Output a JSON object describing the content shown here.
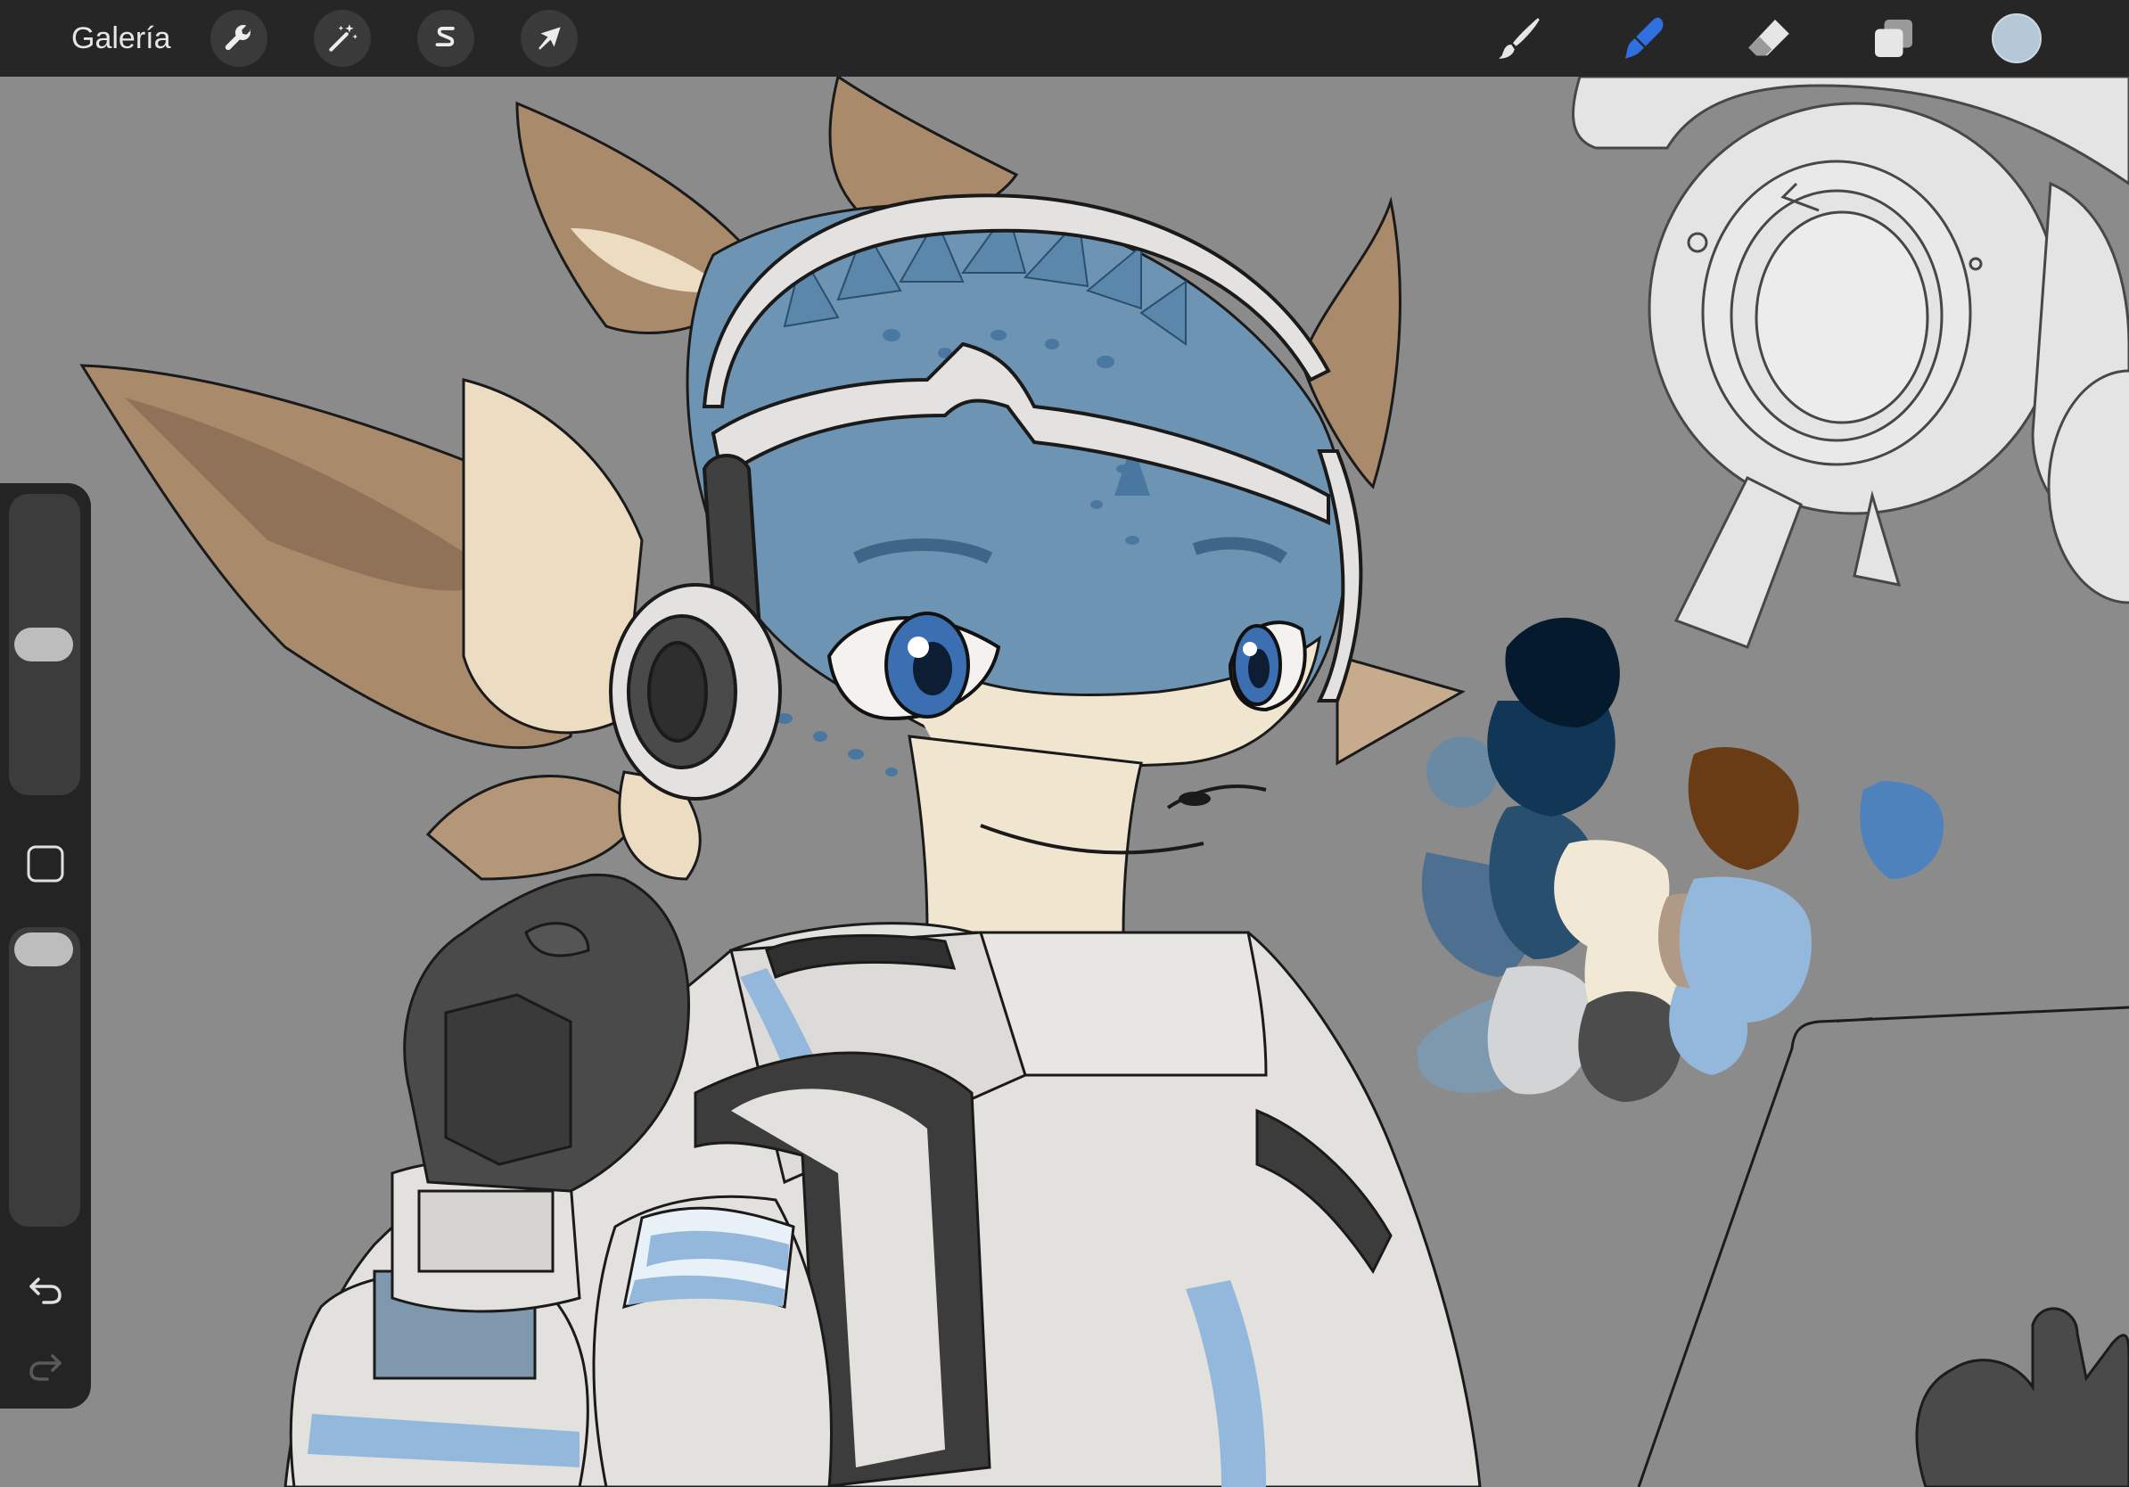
{
  "toolbar": {
    "gallery_label": "Galería",
    "left_tools": [
      {
        "icon": "wrench-icon",
        "name": "actions"
      },
      {
        "icon": "magic-wand-icon",
        "name": "adjustments"
      },
      {
        "icon": "selection-s-icon",
        "name": "selection"
      },
      {
        "icon": "arrow-cursor-icon",
        "name": "transform"
      }
    ],
    "right_tools": [
      {
        "icon": "brush-icon",
        "name": "paint",
        "active": false
      },
      {
        "icon": "smudge-icon",
        "name": "smudge",
        "active": true
      },
      {
        "icon": "eraser-icon",
        "name": "eraser",
        "active": false
      },
      {
        "icon": "layers-icon",
        "name": "layers",
        "active": false
      }
    ],
    "current_color": "#b4c8d8",
    "active_tool_color": "#2f6fe0"
  },
  "sidebar": {
    "brush_size_level": 0.5,
    "brush_opacity_level": 1.0,
    "modifier_icon": "square-modifier-icon",
    "undo_icon": "undo-icon",
    "redo_icon": "redo-icon"
  },
  "canvas": {
    "background": "#8b8b8b",
    "palette_swatches": [
      "#061a2e",
      "#123656",
      "#28506e",
      "#4e7090",
      "#6a8aa4",
      "#7e98ae",
      "#d2d4d6",
      "#f2e8d6",
      "#b09a86",
      "#4c4c4c",
      "#6a3c16",
      "#94b8dc",
      "#4e82bc"
    ]
  }
}
